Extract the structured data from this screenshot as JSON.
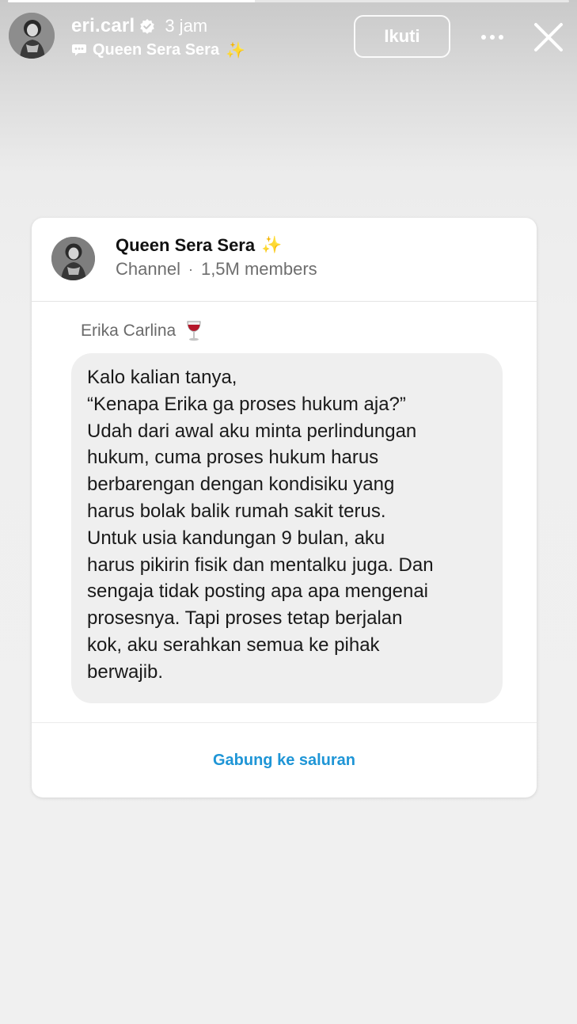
{
  "story": {
    "progress": 0.44,
    "username": "eri.carl",
    "verified": true,
    "time": "3 jam",
    "channel_label": "Queen Sera Sera",
    "channel_label_emoji": "✨",
    "follow_label": "Ikuti"
  },
  "card": {
    "channel_name": "Queen Sera Sera",
    "channel_emoji": "✨",
    "channel_type": "Channel",
    "separator": "·",
    "members": "1,5M members",
    "author": "Erika Carlina",
    "author_emoji": "wine-glass-icon",
    "message_lines": [
      "Kalo kalian tanya,",
      "“Kenapa Erika ga proses hukum aja?”",
      "Udah dari awal aku minta perlindungan",
      "hukum, cuma proses hukum harus",
      "berbarengan dengan kondisiku yang",
      "harus bolak balik rumah sakit terus.",
      "Untuk usia kandungan 9 bulan, aku",
      "harus pikirin fisik dan mentalku juga. Dan",
      "sengaja tidak posting apa apa mengenai",
      "prosesnya. Tapi proses tetap berjalan",
      "kok, aku serahkan semua ke pihak",
      "berwajib."
    ],
    "join_label": "Gabung ke saluran"
  },
  "colors": {
    "link_blue": "#1e95d6",
    "bubble_bg": "#efefef",
    "card_bg": "#ffffff"
  }
}
